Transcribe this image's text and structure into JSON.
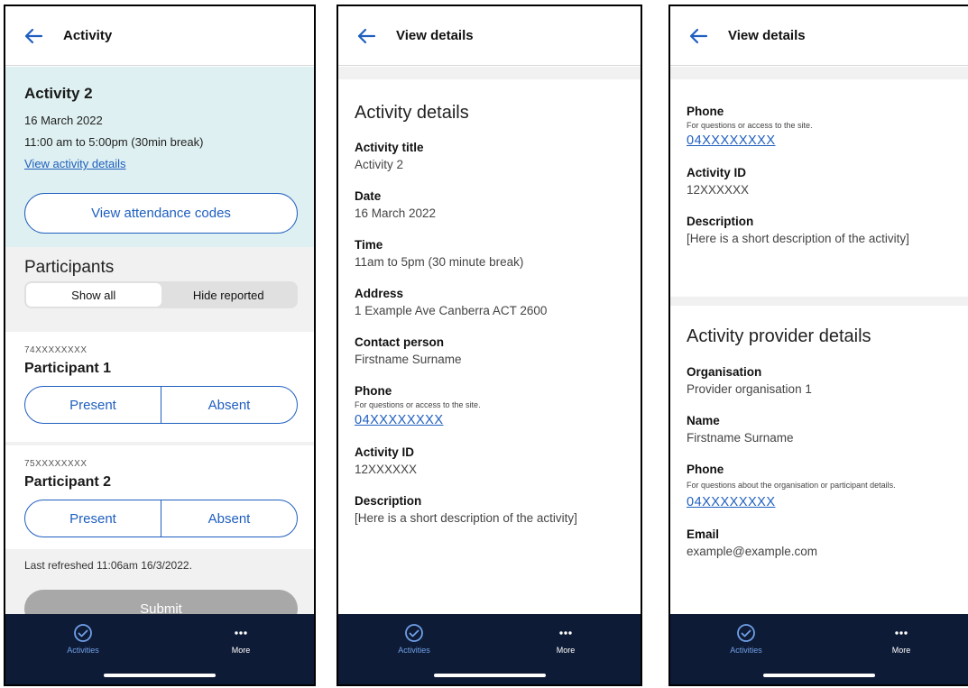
{
  "nav": {
    "activities_label": "Activities",
    "more_label": "More"
  },
  "screen1": {
    "header_title": "Activity",
    "activity_name": "Activity 2",
    "date": "16 March 2022",
    "time": "11:00 am to 5:00pm (30min break)",
    "details_link": "View activity details",
    "codes_button": "View attendance codes",
    "participants_title": "Participants",
    "filter": {
      "show_all": "Show all",
      "hide_reported": "Hide reported"
    },
    "participants": [
      {
        "id": "74XXXXXXXX",
        "name": "Participant 1",
        "present": "Present",
        "absent": "Absent"
      },
      {
        "id": "75XXXXXXXX",
        "name": "Participant 2",
        "present": "Present",
        "absent": "Absent"
      }
    ],
    "last_refreshed": "Last refreshed  11:06am 16/3/2022.",
    "submit": "Submit"
  },
  "screen2": {
    "header_title": "View details",
    "section_title": "Activity details",
    "fields": {
      "title_label": "Activity title",
      "title_value": "Activity 2",
      "date_label": "Date",
      "date_value": "16 March 2022",
      "time_label": "Time",
      "time_value": "11am to 5pm (30 minute break)",
      "address_label": "Address",
      "address_value": "1 Example Ave Canberra ACT 2600",
      "contact_label": "Contact person",
      "contact_value": "Firstname Surname",
      "phone_label": "Phone",
      "phone_note": "For questions or access to the site.",
      "phone_value": "04XXXXXXXX",
      "id_label": "Activity ID",
      "id_value": "12XXXXXX",
      "desc_label": "Description",
      "desc_value": "[Here is a short description of the activity]"
    }
  },
  "screen3": {
    "header_title": "View details",
    "phone_label": "Phone",
    "phone_note": "For questions or access to the site.",
    "phone_value": "04XXXXXXXX",
    "id_label": "Activity ID",
    "id_value": "12XXXXXX",
    "desc_label": "Description",
    "desc_value": "[Here is a short description of the activity]",
    "provider_title": "Activity provider details",
    "org_label": "Organisation",
    "org_value": "Provider organisation 1",
    "name_label": "Name",
    "name_value": "Firstname Surname",
    "pphone_label": "Phone",
    "pphone_note": "For questions  about the organisation or participant details.",
    "pphone_value": "04XXXXXXXX",
    "email_label": "Email",
    "email_value": "example@example.com"
  }
}
